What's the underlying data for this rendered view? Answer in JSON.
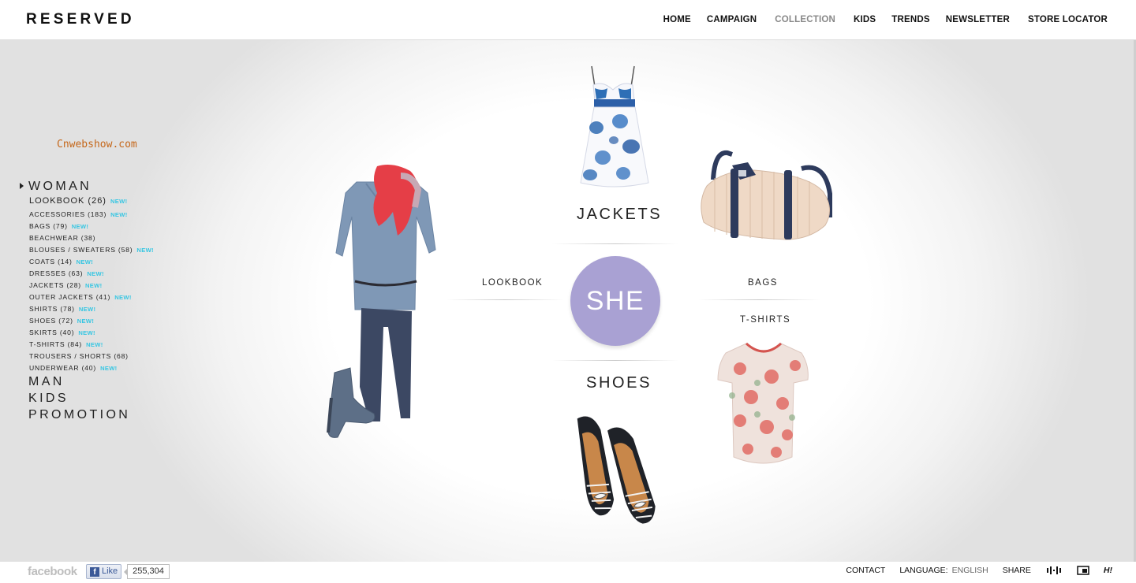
{
  "header": {
    "logo": "RESERVED",
    "nav": [
      "HOME",
      "CAMPAIGN",
      "COLLECTION",
      "KIDS",
      "TRENDS",
      "NEWSLETTER",
      "STORE LOCATOR"
    ],
    "active_nav": "COLLECTION"
  },
  "watermark": "Cnwebshow.com",
  "sidebar": {
    "woman": "WOMAN",
    "lookbook": "LOOKBOOK (26)",
    "items": [
      {
        "label": "ACCESSORIES (183)",
        "new": "NEW!"
      },
      {
        "label": "BAGS (79)",
        "new": "NEW!"
      },
      {
        "label": "BEACHWEAR (38)",
        "new": ""
      },
      {
        "label": "BLOUSES / SWEATERS (58)",
        "new": "NEW!"
      },
      {
        "label": "COATS (14)",
        "new": "NEW!"
      },
      {
        "label": "DRESSES (63)",
        "new": "NEW!"
      },
      {
        "label": "JACKETS (28)",
        "new": "NEW!"
      },
      {
        "label": "OUTER JACKETS (41)",
        "new": "NEW!"
      },
      {
        "label": "SHIRTS (78)",
        "new": "NEW!"
      },
      {
        "label": "SHOES (72)",
        "new": "NEW!"
      },
      {
        "label": "SKIRTS (40)",
        "new": "NEW!"
      },
      {
        "label": "T-SHIRTS (84)",
        "new": "NEW!"
      },
      {
        "label": "TROUSERS / SHORTS (68)",
        "new": ""
      },
      {
        "label": "UNDERWEAR (40)",
        "new": "NEW!"
      }
    ],
    "lookbook_new": "NEW!",
    "man": "MAN",
    "kids": "KIDS",
    "promotion": "PROMOTION"
  },
  "center": {
    "she": "SHE",
    "jackets": "JACKETS",
    "shoes": "SHOES",
    "lookbook": "LOOKBOOK",
    "bags": "BAGS",
    "tshirts": "T-SHIRTS"
  },
  "footer": {
    "facebook": "facebook",
    "like": "Like",
    "like_count": "255,304",
    "contact": "CONTACT",
    "language_label": "LANGUAGE:",
    "language_value": "ENGLISH",
    "share": "SHARE",
    "hi": "H!"
  },
  "colors": {
    "she_circle": "#a9a1d3",
    "new_badge": "#36c6e2",
    "watermark": "#c5671a"
  }
}
